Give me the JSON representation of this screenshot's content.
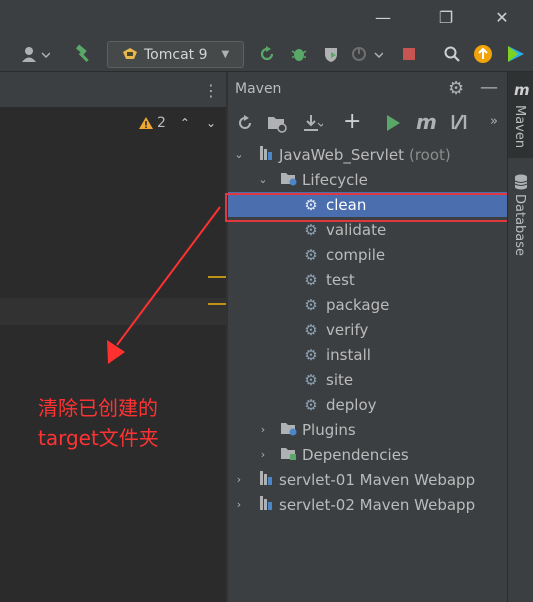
{
  "run_config": "Tomcat 9",
  "inspections": {
    "warning_count": "2"
  },
  "maven": {
    "title": "Maven",
    "tree": {
      "root": {
        "label": "JavaWeb_Servlet",
        "suffix": "(root)"
      },
      "lifecycle": {
        "label": "Lifecycle",
        "goals": [
          "clean",
          "validate",
          "compile",
          "test",
          "package",
          "verify",
          "install",
          "site",
          "deploy"
        ]
      },
      "plugins": "Plugins",
      "dependencies": "Dependencies",
      "modules": [
        "servlet-01 Maven Webapp",
        "servlet-02 Maven Webapp"
      ]
    }
  },
  "right_strip": {
    "maven_label": "Maven",
    "database_label": "Database"
  },
  "annotation": {
    "line1": "清除已创建的",
    "line2": "target文件夹"
  },
  "colors": {
    "selection": "#4b6eaf",
    "highlight_box": "#e0383e",
    "annotation": "#ff3333"
  }
}
